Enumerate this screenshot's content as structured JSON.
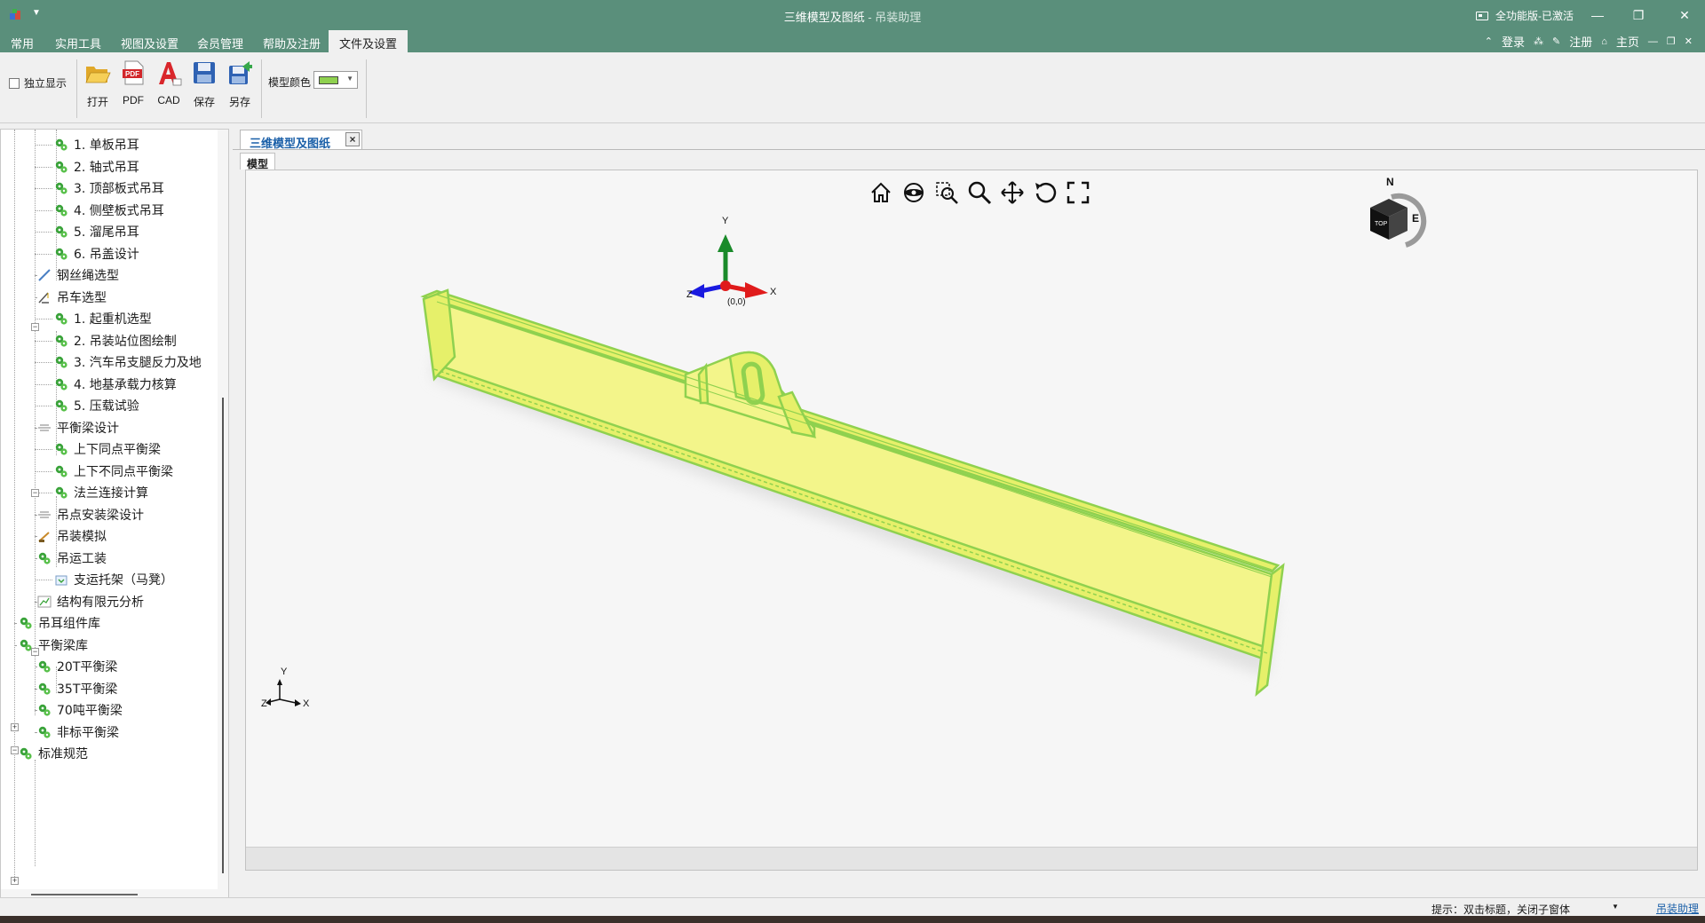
{
  "window": {
    "title_main": "三维模型及图纸",
    "title_sep": " - ",
    "title_sub": "吊装助理",
    "license": "全功能版-已激活",
    "minimize": "—",
    "restore": "❐",
    "close": "✕"
  },
  "ribbon_tabs": [
    {
      "label": "常用"
    },
    {
      "label": "实用工具"
    },
    {
      "label": "视图及设置"
    },
    {
      "label": "会员管理"
    },
    {
      "label": "帮助及注册"
    },
    {
      "label": "文件及设置",
      "active": true
    }
  ],
  "account": {
    "login": "登录",
    "register": "注册",
    "home": "主页"
  },
  "ribbon": {
    "standalone_label": "独立显示",
    "buttons": {
      "open": "打开",
      "pdf": "PDF",
      "cad": "CAD",
      "save": "保存",
      "save_as": "另存"
    },
    "model_color_label": "模型颜色",
    "model_color_value": "#8fd14f"
  },
  "tree": {
    "items": [
      {
        "label": "1. 单板吊耳",
        "icon": "green-gear-icon"
      },
      {
        "label": "2. 轴式吊耳",
        "icon": "green-gear-icon"
      },
      {
        "label": "3. 顶部板式吊耳",
        "icon": "green-gear-icon"
      },
      {
        "label": "4. 侧壁板式吊耳",
        "icon": "green-gear-icon"
      },
      {
        "label": "5. 溜尾吊耳",
        "icon": "green-gear-icon"
      },
      {
        "label": "6. 吊盖设计",
        "icon": "green-gear-icon"
      },
      {
        "label": "钢丝绳选型",
        "icon": "wire-rope-icon"
      },
      {
        "label": "吊车选型",
        "icon": "crane-icon"
      },
      {
        "label": "1. 起重机选型",
        "icon": "green-gear-icon"
      },
      {
        "label": "2. 吊装站位图绘制",
        "icon": "green-gear-icon"
      },
      {
        "label": "3. 汽车吊支腿反力及地",
        "icon": "green-gear-icon"
      },
      {
        "label": "4. 地基承载力核算",
        "icon": "green-gear-icon"
      },
      {
        "label": "5. 压载试验",
        "icon": "green-gear-icon"
      },
      {
        "label": "平衡梁设计",
        "icon": "beam-icon"
      },
      {
        "label": "上下同点平衡梁",
        "icon": "green-gear-icon"
      },
      {
        "label": "上下不同点平衡梁",
        "icon": "green-gear-icon"
      },
      {
        "label": "法兰连接计算",
        "icon": "green-gear-icon"
      },
      {
        "label": "吊点安装梁设计",
        "icon": "beam-icon"
      },
      {
        "label": "吊装模拟",
        "icon": "crane-sim-icon"
      },
      {
        "label": "吊运工装",
        "icon": "green-gear-icon"
      },
      {
        "label": "支运托架（马凳）",
        "icon": "bracket-icon"
      },
      {
        "label": "结构有限元分析",
        "icon": "fea-chart-icon"
      },
      {
        "label": "吊耳组件库",
        "icon": "green-gear-icon"
      },
      {
        "label": "平衡梁库",
        "icon": "green-gear-icon"
      },
      {
        "label": "20T平衡梁",
        "icon": "green-gear-icon"
      },
      {
        "label": "35T平衡梁",
        "icon": "green-gear-icon"
      },
      {
        "label": "70吨平衡梁",
        "icon": "green-gear-icon"
      },
      {
        "label": "非标平衡梁",
        "icon": "green-gear-icon"
      },
      {
        "label": "标准规范",
        "icon": "green-gear-icon"
      }
    ]
  },
  "document": {
    "tab_label": "三维模型及图纸",
    "tab_close": "×",
    "inner_tab": "模型",
    "gizmo": {
      "y": "Y",
      "x": "X",
      "z": "Z",
      "origin": "(0,0)"
    },
    "corner_axes": {
      "y": "Y",
      "x": "X",
      "z": "Z"
    },
    "viewcube": {
      "north": "N",
      "east": "E",
      "top_face": "TOP"
    },
    "model_color": "#f3f58a",
    "model_edge_color": "#8fd14f"
  },
  "status": {
    "hint": "提示：双击标题，关闭子窗体",
    "link": "吊装助理"
  }
}
